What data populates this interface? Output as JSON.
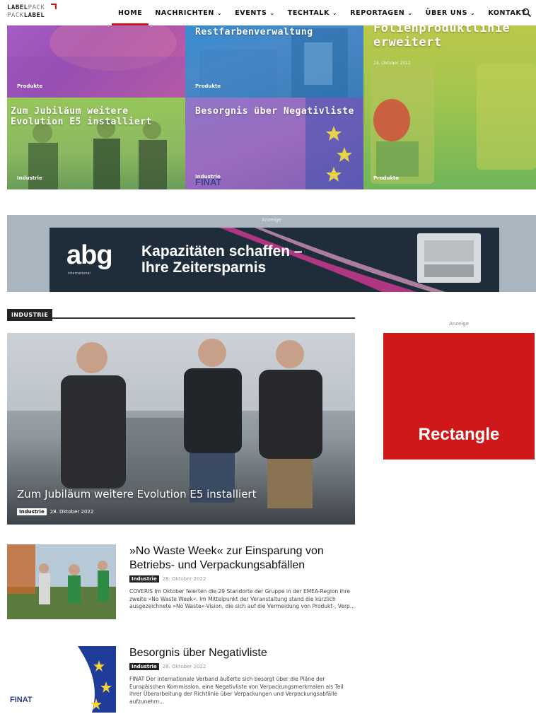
{
  "header": {
    "logo_line1_a": "LABEL",
    "logo_line1_b": "PACK",
    "logo_line2_a": "PACK",
    "logo_line2_b": "LABEL",
    "nav": [
      {
        "label": "HOME",
        "dropdown": false
      },
      {
        "label": "NACHRICHTEN",
        "dropdown": true
      },
      {
        "label": "EVENTS",
        "dropdown": true
      },
      {
        "label": "TECHTALK",
        "dropdown": true
      },
      {
        "label": "REPORTAGEN",
        "dropdown": true
      },
      {
        "label": "ÜBER UNS",
        "dropdown": true
      },
      {
        "label": "KONTAKT",
        "dropdown": false
      }
    ],
    "chevron": "⌄",
    "search_icon": "search-icon"
  },
  "hero": {
    "tiles": [
      {
        "title": "",
        "category": "Produkte"
      },
      {
        "title": "Restfarbenverwaltung",
        "category": "Produkte"
      },
      {
        "title": "Folienproduktlinie erweitert",
        "category": "Produkte",
        "date": "28. Oktober 2022"
      },
      {
        "title": "Zum Jubiläum weitere Evolution E5 installiert",
        "category": "Industrie"
      },
      {
        "title": "Besorgnis über Negativliste",
        "category": "Industrie"
      }
    ]
  },
  "ad_strip": {
    "label": "Anzeige",
    "brand": "abg",
    "brand_sub": "international",
    "headline_line1": "Kapazitäten schaffen –",
    "headline_line2": "Ihre Zeitersparnis"
  },
  "section": {
    "label": "INDUSTRIE"
  },
  "feature": {
    "title": "Zum Jubiläum weitere Evolution E5 installiert",
    "category": "Industrie",
    "date": "28. Oktober 2022"
  },
  "side_ad": {
    "label": "Anzeige",
    "text": "Rectangle",
    "color": "#d0181b"
  },
  "articles": [
    {
      "title": "»No Waste Week« zur Einsparung von Betriebs- und Verpackungsabfällen",
      "category": "Industrie",
      "date": "28. Oktober 2022",
      "excerpt": "COVERIS   Im Oktober feierten die 29 Standorte der Gruppe in der EMEA-Region ihre zweite »No Waste Week«. Im Mittelpunkt der Veranstaltung stand die kürzlich ausgezeichnete »No Waste«-Vision, die sich auf die Vermeidung von Produkt-, Verp..."
    },
    {
      "title": "Besorgnis über Negativliste",
      "category": "Industrie",
      "date": "28. Oktober 2022",
      "excerpt": "FINAT   Der internationale Verband äußerte sich besorgt über die Pläne der Europäischen Kommission, eine Negativliste von Verpackungsmerkmalen als Teil ihrer Überarbeitung der Richtlinie über Verpackungen und Verpackungsabfälle aufzunehm...",
      "thumb_logo": "FINAT"
    }
  ],
  "finat_logo_hero": "FINAT",
  "accent_color": "#d0181b"
}
